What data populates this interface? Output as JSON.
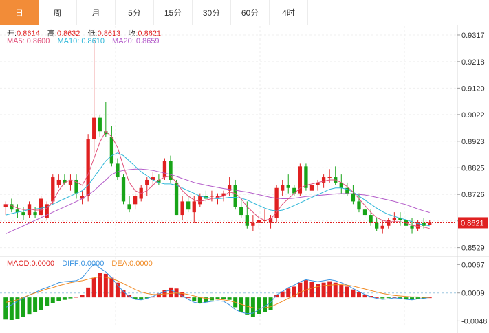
{
  "tabs": [
    {
      "label": "日",
      "active": true
    },
    {
      "label": "周",
      "active": false
    },
    {
      "label": "月",
      "active": false
    },
    {
      "label": "5分",
      "active": false
    },
    {
      "label": "15分",
      "active": false
    },
    {
      "label": "30分",
      "active": false
    },
    {
      "label": "60分",
      "active": false
    },
    {
      "label": "4时",
      "active": false
    }
  ],
  "ohlc_legend": {
    "open_label": "开:",
    "open": "0.8614",
    "high_label": "高:",
    "high": "0.8632",
    "low_label": "低:",
    "low": "0.8613",
    "close_label": "收:",
    "close": "0.8621"
  },
  "ma_legend": {
    "ma5_label": "MA5:",
    "ma5": "0.8600",
    "ma10_label": "MA10:",
    "ma10": "0.8610",
    "ma20_label": "MA20:",
    "ma20": "0.8659"
  },
  "macd_legend": {
    "macd_label": "MACD:",
    "macd": "0.0000",
    "diff_label": "DIFF:",
    "diff": "0.0000",
    "dea_label": "DEA:",
    "dea": "0.0000"
  },
  "colors": {
    "up": "#e02020",
    "down": "#18a418",
    "ma5": "#e0507a",
    "ma10": "#2bb6d8",
    "ma20": "#b35bc9",
    "diff": "#3a93e0",
    "dea": "#f08a24",
    "accent": "#f28c38",
    "price_tag": "#e02020"
  },
  "chart_data": [
    {
      "type": "candlestick",
      "title": "",
      "price_axis_ticks": [
        "0.9317",
        "0.9218",
        "0.9120",
        "0.9022",
        "0.8923",
        "0.8825",
        "0.8726",
        "0.8628",
        "0.8529"
      ],
      "ylim": [
        0.85,
        0.935
      ],
      "last_price": "0.8621",
      "candles": [
        [
          0.868,
          0.87,
          0.865,
          0.869
        ],
        [
          0.869,
          0.871,
          0.866,
          0.867
        ],
        [
          0.867,
          0.869,
          0.864,
          0.866
        ],
        [
          0.866,
          0.868,
          0.863,
          0.865
        ],
        [
          0.865,
          0.87,
          0.864,
          0.869
        ],
        [
          0.866,
          0.868,
          0.864,
          0.865
        ],
        [
          0.865,
          0.872,
          0.864,
          0.871
        ],
        [
          0.864,
          0.87,
          0.863,
          0.869
        ],
        [
          0.87,
          0.88,
          0.869,
          0.879
        ],
        [
          0.876,
          0.88,
          0.875,
          0.878
        ],
        [
          0.878,
          0.88,
          0.876,
          0.877
        ],
        [
          0.876,
          0.88,
          0.874,
          0.878
        ],
        [
          0.878,
          0.88,
          0.871,
          0.873
        ],
        [
          0.871,
          0.874,
          0.869,
          0.872
        ],
        [
          0.872,
          0.895,
          0.87,
          0.893
        ],
        [
          0.893,
          0.93,
          0.888,
          0.901
        ],
        [
          0.901,
          0.902,
          0.894,
          0.896
        ],
        [
          0.896,
          0.907,
          0.894,
          0.895
        ],
        [
          0.894,
          0.898,
          0.883,
          0.884
        ],
        [
          0.884,
          0.886,
          0.878,
          0.879
        ],
        [
          0.879,
          0.88,
          0.869,
          0.87
        ],
        [
          0.869,
          0.872,
          0.866,
          0.867
        ],
        [
          0.869,
          0.873,
          0.867,
          0.872
        ],
        [
          0.871,
          0.876,
          0.87,
          0.875
        ],
        [
          0.876,
          0.879,
          0.872,
          0.878
        ],
        [
          0.878,
          0.881,
          0.876,
          0.879
        ],
        [
          0.878,
          0.88,
          0.876,
          0.877
        ],
        [
          0.879,
          0.886,
          0.878,
          0.885
        ],
        [
          0.885,
          0.887,
          0.877,
          0.878
        ],
        [
          0.877,
          0.878,
          0.865,
          0.865
        ],
        [
          0.865,
          0.872,
          0.863,
          0.87
        ],
        [
          0.87,
          0.872,
          0.866,
          0.867
        ],
        [
          0.866,
          0.872,
          0.862,
          0.87
        ],
        [
          0.869,
          0.873,
          0.868,
          0.872
        ],
        [
          0.872,
          0.874,
          0.87,
          0.871
        ],
        [
          0.872,
          0.874,
          0.87,
          0.872
        ],
        [
          0.871,
          0.873,
          0.869,
          0.872
        ],
        [
          0.872,
          0.874,
          0.87,
          0.873
        ],
        [
          0.874,
          0.879,
          0.872,
          0.876
        ],
        [
          0.876,
          0.878,
          0.867,
          0.868
        ],
        [
          0.868,
          0.871,
          0.864,
          0.865
        ],
        [
          0.865,
          0.87,
          0.86,
          0.861
        ],
        [
          0.861,
          0.865,
          0.859,
          0.862
        ],
        [
          0.862,
          0.865,
          0.86,
          0.863
        ],
        [
          0.863,
          0.867,
          0.862,
          0.863
        ],
        [
          0.862,
          0.865,
          0.86,
          0.864
        ],
        [
          0.864,
          0.876,
          0.862,
          0.875
        ],
        [
          0.874,
          0.878,
          0.872,
          0.876
        ],
        [
          0.876,
          0.88,
          0.873,
          0.875
        ],
        [
          0.875,
          0.876,
          0.872,
          0.873
        ],
        [
          0.873,
          0.884,
          0.872,
          0.883
        ],
        [
          0.883,
          0.884,
          0.874,
          0.875
        ],
        [
          0.874,
          0.878,
          0.872,
          0.876
        ],
        [
          0.876,
          0.878,
          0.874,
          0.877
        ],
        [
          0.877,
          0.88,
          0.875,
          0.879
        ],
        [
          0.879,
          0.882,
          0.877,
          0.879
        ],
        [
          0.879,
          0.883,
          0.876,
          0.877
        ],
        [
          0.877,
          0.88,
          0.873,
          0.875
        ],
        [
          0.875,
          0.877,
          0.872,
          0.873
        ],
        [
          0.873,
          0.876,
          0.869,
          0.87
        ],
        [
          0.87,
          0.873,
          0.866,
          0.867
        ],
        [
          0.867,
          0.872,
          0.864,
          0.865
        ],
        [
          0.865,
          0.867,
          0.861,
          0.862
        ],
        [
          0.862,
          0.864,
          0.859,
          0.86
        ],
        [
          0.86,
          0.863,
          0.858,
          0.861
        ],
        [
          0.861,
          0.864,
          0.86,
          0.863
        ],
        [
          0.863,
          0.866,
          0.862,
          0.864
        ],
        [
          0.864,
          0.866,
          0.861,
          0.863
        ],
        [
          0.863,
          0.865,
          0.86,
          0.861
        ],
        [
          0.861,
          0.864,
          0.858,
          0.86
        ],
        [
          0.86,
          0.863,
          0.859,
          0.862
        ],
        [
          0.862,
          0.864,
          0.86,
          0.861
        ],
        [
          0.8614,
          0.8632,
          0.8613,
          0.8621
        ]
      ],
      "ma5": [
        0.869,
        0.8685,
        0.8675,
        0.867,
        0.8672,
        0.8668,
        0.8668,
        0.8675,
        0.87,
        0.874,
        0.877,
        0.878,
        0.8772,
        0.876,
        0.88,
        0.886,
        0.892,
        0.896,
        0.894,
        0.89,
        0.883,
        0.877,
        0.874,
        0.873,
        0.874,
        0.876,
        0.878,
        0.879,
        0.8795,
        0.877,
        0.874,
        0.872,
        0.8705,
        0.87,
        0.8705,
        0.871,
        0.8715,
        0.872,
        0.8735,
        0.873,
        0.871,
        0.868,
        0.866,
        0.864,
        0.863,
        0.8635,
        0.866,
        0.869,
        0.871,
        0.873,
        0.875,
        0.876,
        0.8765,
        0.877,
        0.8775,
        0.878,
        0.878,
        0.877,
        0.8755,
        0.8735,
        0.871,
        0.8685,
        0.866,
        0.864,
        0.863,
        0.8625,
        0.8625,
        0.8625,
        0.862,
        0.8612,
        0.8608,
        0.8605,
        0.86
      ],
      "ma10": [
        0.865,
        0.8655,
        0.866,
        0.8665,
        0.867,
        0.8672,
        0.8675,
        0.868,
        0.869,
        0.87,
        0.871,
        0.872,
        0.873,
        0.874,
        0.876,
        0.879,
        0.882,
        0.885,
        0.887,
        0.888,
        0.887,
        0.885,
        0.883,
        0.881,
        0.8795,
        0.878,
        0.877,
        0.8765,
        0.8765,
        0.876,
        0.875,
        0.874,
        0.873,
        0.872,
        0.8715,
        0.8712,
        0.871,
        0.8712,
        0.8715,
        0.8715,
        0.8712,
        0.8705,
        0.8695,
        0.8685,
        0.8675,
        0.8668,
        0.8665,
        0.8668,
        0.8675,
        0.8685,
        0.8695,
        0.8705,
        0.8715,
        0.8725,
        0.8735,
        0.8745,
        0.875,
        0.875,
        0.8745,
        0.8735,
        0.872,
        0.8705,
        0.869,
        0.8675,
        0.8662,
        0.8652,
        0.8645,
        0.8638,
        0.8632,
        0.8625,
        0.8618,
        0.8614,
        0.861
      ],
      "ma20": [
        0.858,
        0.859,
        0.86,
        0.861,
        0.862,
        0.863,
        0.864,
        0.865,
        0.866,
        0.867,
        0.868,
        0.869,
        0.87,
        0.871,
        0.8725,
        0.874,
        0.876,
        0.878,
        0.88,
        0.881,
        0.8815,
        0.8818,
        0.882,
        0.882,
        0.8818,
        0.8815,
        0.881,
        0.8805,
        0.88,
        0.8793,
        0.8785,
        0.8778,
        0.877,
        0.8765,
        0.876,
        0.8756,
        0.8752,
        0.8748,
        0.8745,
        0.8742,
        0.8738,
        0.8735,
        0.873,
        0.8725,
        0.872,
        0.8715,
        0.8712,
        0.871,
        0.871,
        0.8712,
        0.8715,
        0.8718,
        0.872,
        0.8722,
        0.8724,
        0.8726,
        0.8728,
        0.8729,
        0.8729,
        0.8728,
        0.8726,
        0.8724,
        0.872,
        0.8715,
        0.871,
        0.8705,
        0.87,
        0.8694,
        0.8688,
        0.868,
        0.8672,
        0.8665,
        0.8659
      ]
    },
    {
      "type": "bar",
      "title": "MACD",
      "macd_axis_ticks": [
        "0.0067",
        "0.0009",
        "-0.0048"
      ],
      "ylim": [
        -0.006,
        0.008
      ],
      "histogram": [
        -0.0045,
        -0.0046,
        -0.0044,
        -0.004,
        -0.0035,
        -0.003,
        -0.0025,
        -0.0018,
        -0.0012,
        -0.0008,
        -0.0005,
        -0.0002,
        0.0001,
        0.0005,
        0.002,
        0.004,
        0.005,
        0.0048,
        0.004,
        0.003,
        0.0015,
        0.0005,
        -0.0003,
        -0.0005,
        -0.0002,
        0.0002,
        0.0008,
        0.0015,
        0.002,
        0.0018,
        0.001,
        0.0,
        -0.0008,
        -0.0012,
        -0.001,
        -0.0006,
        -0.0004,
        -0.0003,
        -0.0005,
        -0.002,
        -0.003,
        -0.0036,
        -0.004,
        -0.0034,
        -0.003,
        -0.0025,
        0.0005,
        0.0012,
        0.0018,
        0.0022,
        0.003,
        0.0035,
        0.0032,
        0.0028,
        0.003,
        0.0033,
        0.003,
        0.0026,
        0.0022,
        0.0016,
        0.001,
        0.0006,
        0.0003,
        0.0,
        -0.0002,
        -0.0001,
        0.0001,
        -0.0002,
        -0.0004,
        -0.0005,
        -0.0003,
        -0.0002,
        0.0
      ],
      "diff": [
        -0.002,
        -0.0015,
        -0.0008,
        -0.0002,
        0.0005,
        0.001,
        0.0016,
        0.002,
        0.0025,
        0.003,
        0.0032,
        0.0033,
        0.0034,
        0.004,
        0.0055,
        0.0068,
        0.006,
        0.0052,
        0.004,
        0.0025,
        0.0012,
        0.0002,
        -0.0004,
        -0.0005,
        -0.0002,
        0.0002,
        0.0007,
        0.0012,
        0.0015,
        0.001,
        0.0003,
        -0.0004,
        -0.001,
        -0.0012,
        -0.001,
        -0.0008,
        -0.0007,
        -0.0008,
        -0.0015,
        -0.0025,
        -0.003,
        -0.0033,
        -0.0032,
        -0.0025,
        -0.0018,
        -0.001,
        0.0005,
        0.0012,
        0.002,
        0.0025,
        0.0032,
        0.0036,
        0.0034,
        0.0032,
        0.0034,
        0.0036,
        0.0034,
        0.003,
        0.0025,
        0.0018,
        0.0012,
        0.0006,
        0.0001,
        -0.0002,
        -0.0004,
        -0.0003,
        -0.0001,
        -0.0002,
        -0.0004,
        -0.0005,
        -0.0003,
        -0.0002,
        0.0
      ],
      "dea": [
        -0.001,
        -0.0008,
        -0.0005,
        0.0,
        0.0005,
        0.0009,
        0.0013,
        0.0017,
        0.002,
        0.0024,
        0.0027,
        0.003,
        0.0032,
        0.0034,
        0.0037,
        0.004,
        0.0042,
        0.0041,
        0.0038,
        0.0034,
        0.0028,
        0.0022,
        0.0016,
        0.0011,
        0.0008,
        0.0006,
        0.0006,
        0.0007,
        0.0008,
        0.0009,
        0.0008,
        0.0006,
        0.0003,
        0.0,
        -0.0002,
        -0.0003,
        -0.0004,
        -0.0005,
        -0.0007,
        -0.001,
        -0.0014,
        -0.0018,
        -0.0021,
        -0.0022,
        -0.0021,
        -0.0019,
        -0.0014,
        -0.0008,
        -0.0002,
        0.0004,
        0.001,
        0.0015,
        0.0019,
        0.0022,
        0.0024,
        0.0025,
        0.0026,
        0.0026,
        0.0025,
        0.0023,
        0.002,
        0.0017,
        0.0014,
        0.0011,
        0.0008,
        0.0006,
        0.0004,
        0.0003,
        0.0002,
        0.0001,
        0.0001,
        0.0,
        0.0
      ]
    }
  ]
}
